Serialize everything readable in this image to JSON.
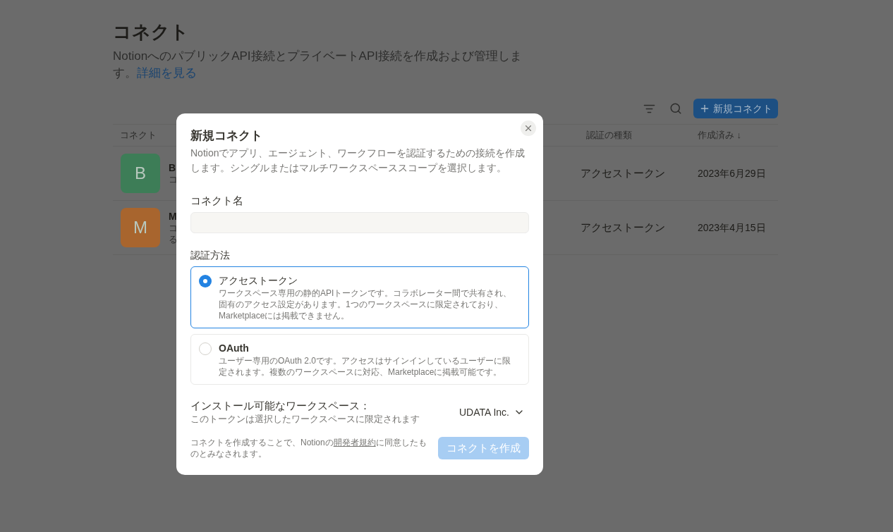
{
  "page": {
    "title": "コネクト",
    "description": "NotionへのパブリックAPI接続とプライベートAPI接続を作成および管理します。",
    "learn_more_link": "詳細を見る",
    "new_button": "新規コネクト"
  },
  "table": {
    "columns": [
      "コネクト",
      "認証の種類",
      "作成済み ↓"
    ],
    "rows": [
      {
        "avatar_letter": "B",
        "color": "#3d7d57",
        "name": "B",
        "description": [
          "コ"
        ],
        "auth_type": "アクセストークン",
        "created": "2023年6月29日"
      },
      {
        "avatar_letter": "M",
        "color": "#a8652e",
        "name": "M",
        "description": [
          "コ",
          "る"
        ],
        "auth_type": "アクセストークン",
        "created": "2023年4月15日"
      }
    ]
  },
  "dialog": {
    "title": "新規コネクト",
    "description": "Notionでアプリ、エージェント、ワークフローを認証するための接続を作成します。シングルまたはマルチワークスペーススコープを選択します。",
    "name_label": "コネクト名",
    "auth_label": "認証方法",
    "auth_options": [
      {
        "title": "アクセストークン",
        "description": "ワークスペース専用の静的APIトークンです。コラボレーター間で共有され、固有のアクセス設定があります。1つのワークスペースに限定されており、Marketplaceには掲載できません。",
        "selected": true
      },
      {
        "title": "OAuth",
        "description": "ユーザー専用のOAuth 2.0です。アクセスはサインインしているユーザーに限定されます。複数のワークスペースに対応、Marketplaceに掲載可能です。",
        "selected": false
      }
    ],
    "workspace_label": "インストール可能なワークスペース：",
    "workspace_hint": "このトークンは選択したワークスペースに限定されます",
    "workspace_value": "UDATA Inc.",
    "terms_before": "コネクトを作成することで、Notionの",
    "terms_link": "開発者規約",
    "terms_after": "に同意したものとみなされます。",
    "create_button": {
      "label": "コネクトを作成",
      "disabled": true
    }
  }
}
